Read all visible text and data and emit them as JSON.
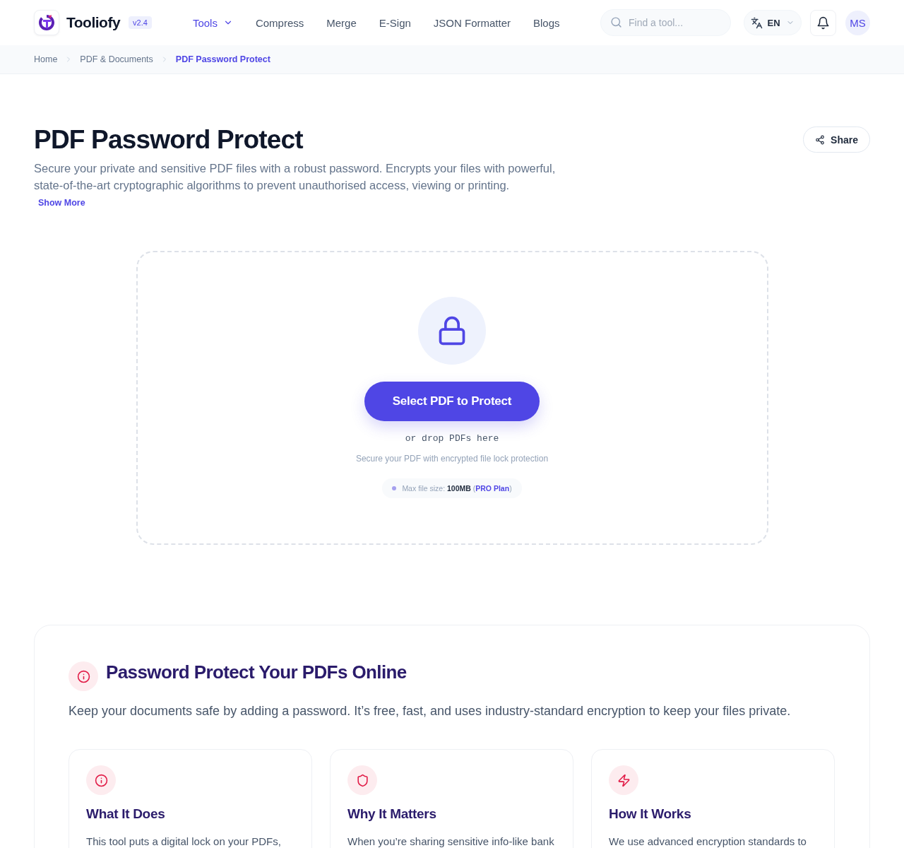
{
  "header": {
    "brand": "Tooliofy",
    "version": "v2.4",
    "nav": [
      {
        "label": "Tools",
        "selected": true,
        "dropdown": true
      },
      {
        "label": "Compress",
        "selected": false,
        "dropdown": false
      },
      {
        "label": "Merge",
        "selected": false,
        "dropdown": false
      },
      {
        "label": "E-Sign",
        "selected": false,
        "dropdown": false
      },
      {
        "label": "JSON Formatter",
        "selected": false,
        "dropdown": false
      },
      {
        "label": "Blogs",
        "selected": false,
        "dropdown": false
      }
    ],
    "search": {
      "placeholder": "Find a tool..."
    },
    "language": "EN",
    "avatar": "MS"
  },
  "breadcrumb": [
    {
      "label": "Home",
      "current": false
    },
    {
      "label": "PDF & Documents",
      "current": false
    },
    {
      "label": "PDF Password Protect",
      "current": true
    }
  ],
  "page": {
    "title": "PDF Password Protect",
    "share": "Share",
    "description": "Secure your private and sensitive PDF files with a robust password. Encrypts your files with powerful, state-of-the-art cryptographic algorithms to prevent unauthorised access, viewing or printing.",
    "show_more": "Show More"
  },
  "upload": {
    "button": "Select PDF to Protect",
    "drop_hint": "or drop PDFs here",
    "subtitle": "Secure your PDF with encrypted file lock protection",
    "limit": {
      "text_before": "Max file size: **100MB** (",
      "link": "PRO Plan",
      "text_after": ")"
    }
  },
  "info": {
    "title": "Password Protect Your PDFs Online",
    "intro": "Keep your documents safe by adding a password. It’s free, fast, and uses industry-standard encryption to keep your files private.",
    "cards": [
      {
        "title": "What It Does",
        "text": "This tool puts a digital lock on your PDFs,"
      },
      {
        "title": "Why It Matters",
        "text": "When you’re sharing sensitive info-like bank"
      },
      {
        "title": "How It Works",
        "text": "We use advanced encryption standards to"
      }
    ]
  }
}
